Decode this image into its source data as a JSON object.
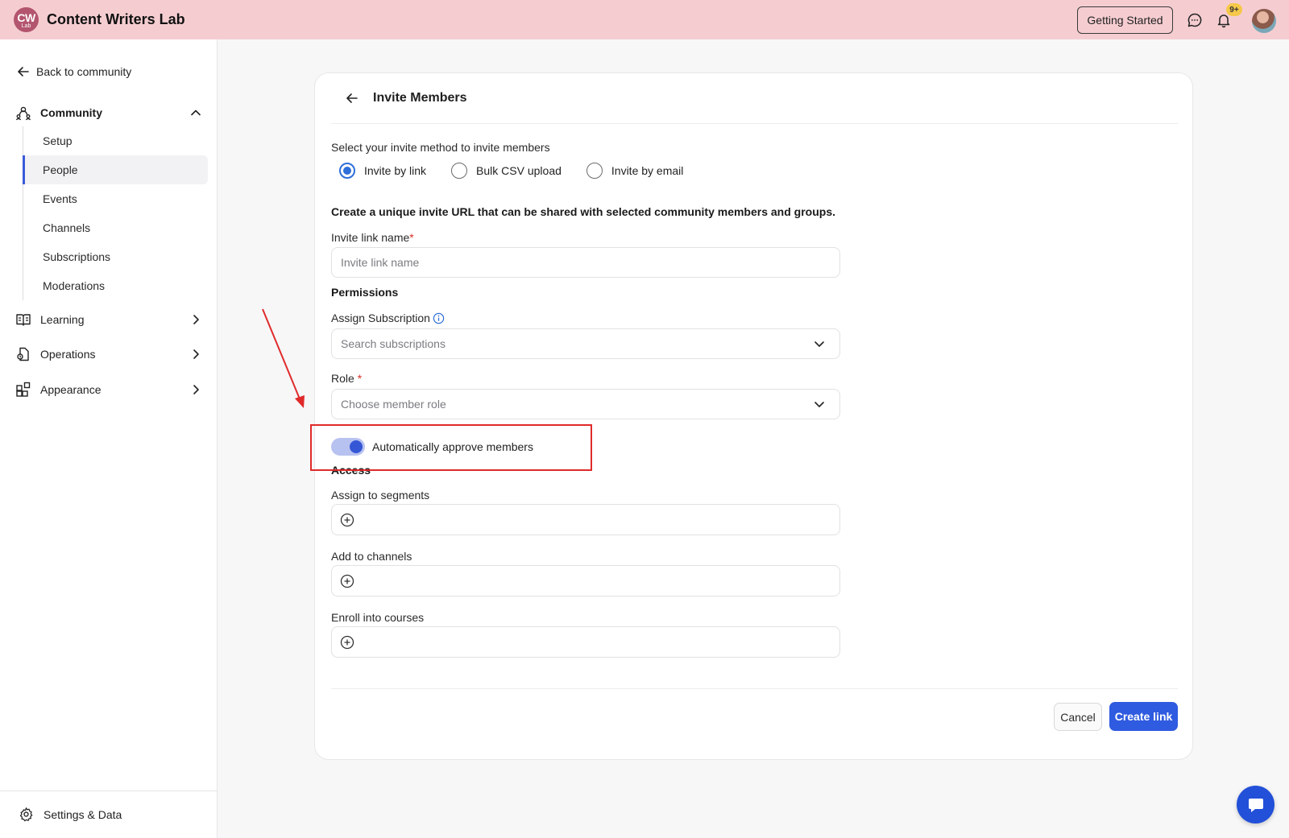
{
  "app": {
    "logo_line1": "CW",
    "logo_line2": "Lab",
    "title": "Content Writers Lab",
    "getting_started": "Getting Started",
    "notification_badge": "9+"
  },
  "sidebar": {
    "back": "Back to community",
    "community": "Community",
    "sub_items": [
      "Setup",
      "People",
      "Events",
      "Channels",
      "Subscriptions",
      "Moderations"
    ],
    "active_item": "People",
    "learning": "Learning",
    "operations": "Operations",
    "appearance": "Appearance",
    "settings": "Settings & Data"
  },
  "card": {
    "title": "Invite Members",
    "method_prompt": "Select your invite method to invite members",
    "methods": [
      "Invite by link",
      "Bulk CSV upload",
      "Invite by email"
    ],
    "selected_method": "Invite by link",
    "description": "Create a unique invite URL that can be shared with selected community members and groups.",
    "link_name_label": "Invite link name",
    "required_mark": "*",
    "link_name_placeholder": "Invite link name",
    "permissions_heading": "Permissions",
    "subscription_label": "Assign Subscription",
    "subscription_placeholder": "Search subscriptions",
    "role_label": "Role",
    "role_placeholder": "Choose member role",
    "auto_approve_label": "Automatically approve members",
    "auto_approve_on": true,
    "access_heading": "Access",
    "segments_label": "Assign to segments",
    "channels_label": "Add to channels",
    "courses_label": "Enroll into courses",
    "cancel": "Cancel",
    "create": "Create link"
  },
  "colors": {
    "topbar": "#f5cdd1",
    "accent": "#2f5be0",
    "annotation": "#e02a2a"
  }
}
